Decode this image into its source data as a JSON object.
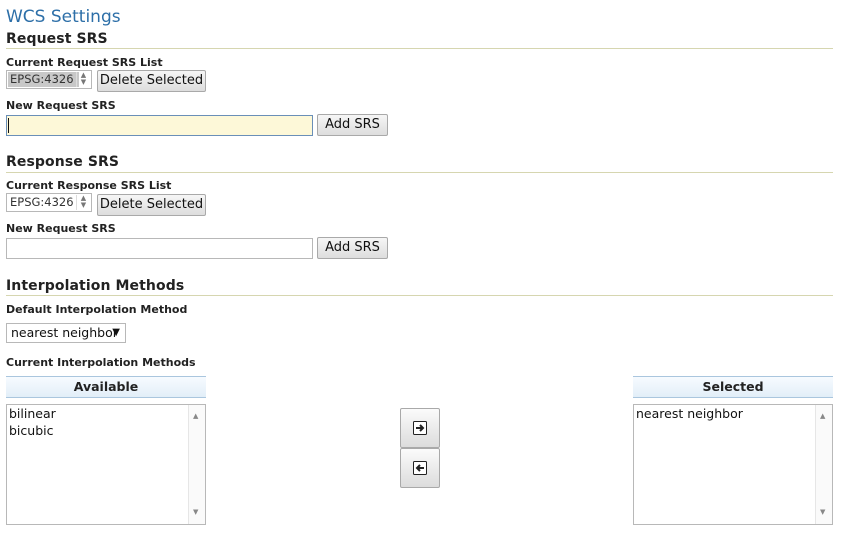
{
  "page": {
    "title": "WCS Settings"
  },
  "request_srs": {
    "section_title": "Request SRS",
    "current_label": "Current Request SRS List",
    "list_items": [
      "EPSG:4326"
    ],
    "delete_label": "Delete Selected",
    "new_label": "New Request SRS",
    "new_value": "",
    "add_label": "Add SRS"
  },
  "response_srs": {
    "section_title": "Response SRS",
    "current_label": "Current Response SRS List",
    "list_items": [
      "EPSG:4326"
    ],
    "delete_label": "Delete Selected",
    "new_label": "New Request SRS",
    "new_value": "",
    "add_label": "Add SRS"
  },
  "interpolation": {
    "section_title": "Interpolation Methods",
    "default_label": "Default Interpolation Method",
    "default_value": "nearest neighbor",
    "current_label": "Current Interpolation Methods",
    "available_header": "Available",
    "available_items": [
      "bilinear",
      "bicubic"
    ],
    "selected_header": "Selected",
    "selected_items": [
      "nearest neighbor"
    ]
  },
  "icons": {
    "move_right": "arrow-right-icon",
    "move_left": "arrow-left-icon"
  },
  "colors": {
    "title": "#2d6fa8",
    "rule": "#d6d6b0",
    "focused_input_bg": "#fdf8d8",
    "header_border": "#aac6de"
  }
}
